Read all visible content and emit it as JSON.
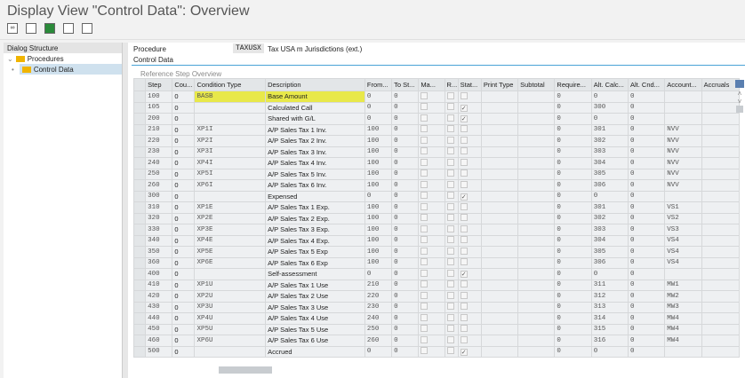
{
  "title": "Display View \"Control Data\": Overview",
  "toolbar": [
    "glasses-icon",
    "select-all-icon",
    "select-block-icon",
    "deselect-all-icon",
    "print-icon"
  ],
  "left": {
    "header": "Dialog Structure",
    "items": [
      {
        "label": "Procedures"
      },
      {
        "label": "Control Data",
        "selected": true
      }
    ]
  },
  "procedure": {
    "label": "Procedure",
    "code": "TAXUSX",
    "description": "Tax USA m Jurisdictions (ext.)"
  },
  "tab": "Control Data",
  "section": "Reference Step Overview",
  "columns": [
    "Step",
    "Cou...",
    "Condition Type",
    "Description",
    "From...",
    "To St...",
    "Ma...",
    "R...",
    "Stat...",
    "Print Type",
    "Subtotal",
    "Require...",
    "Alt. Calc...",
    "Alt. Cnd...",
    "Account...",
    "Accruals"
  ],
  "rows": [
    [
      "100",
      "0",
      "BASB",
      "Base Amount",
      "0",
      "0",
      false,
      false,
      false,
      "",
      "",
      "0",
      "0",
      "0",
      "",
      ""
    ],
    [
      "105",
      "0",
      "",
      "Calculated Call",
      "0",
      "0",
      false,
      false,
      true,
      "",
      "",
      "0",
      "300",
      "0",
      "",
      ""
    ],
    [
      "200",
      "0",
      "",
      "Shared with G/L",
      "0",
      "0",
      false,
      false,
      true,
      "",
      "",
      "0",
      "0",
      "0",
      "",
      ""
    ],
    [
      "210",
      "0",
      "XP1I",
      "A/P Sales Tax 1 Inv.",
      "100",
      "0",
      false,
      false,
      false,
      "",
      "",
      "0",
      "301",
      "0",
      "NVV",
      ""
    ],
    [
      "220",
      "0",
      "XP2I",
      "A/P Sales Tax 2 Inv.",
      "100",
      "0",
      false,
      false,
      false,
      "",
      "",
      "0",
      "302",
      "0",
      "NVV",
      ""
    ],
    [
      "230",
      "0",
      "XP3I",
      "A/P Sales Tax 3 Inv.",
      "100",
      "0",
      false,
      false,
      false,
      "",
      "",
      "0",
      "303",
      "0",
      "NVV",
      ""
    ],
    [
      "240",
      "0",
      "XP4I",
      "A/P Sales Tax 4 Inv.",
      "100",
      "0",
      false,
      false,
      false,
      "",
      "",
      "0",
      "304",
      "0",
      "NVV",
      ""
    ],
    [
      "250",
      "0",
      "XP5I",
      "A/P Sales Tax 5 Inv.",
      "100",
      "0",
      false,
      false,
      false,
      "",
      "",
      "0",
      "305",
      "0",
      "NVV",
      ""
    ],
    [
      "260",
      "0",
      "XP6I",
      "A/P Sales Tax 6 Inv.",
      "100",
      "0",
      false,
      false,
      false,
      "",
      "",
      "0",
      "306",
      "0",
      "NVV",
      ""
    ],
    [
      "300",
      "0",
      "",
      "Expensed",
      "0",
      "0",
      false,
      false,
      true,
      "",
      "",
      "0",
      "0",
      "0",
      "",
      ""
    ],
    [
      "310",
      "0",
      "XP1E",
      "A/P Sales Tax 1 Exp.",
      "100",
      "0",
      false,
      false,
      false,
      "",
      "",
      "0",
      "301",
      "0",
      "VS1",
      ""
    ],
    [
      "320",
      "0",
      "XP2E",
      "A/P Sales Tax 2 Exp.",
      "100",
      "0",
      false,
      false,
      false,
      "",
      "",
      "0",
      "302",
      "0",
      "VS2",
      ""
    ],
    [
      "330",
      "0",
      "XP3E",
      "A/P Sales Tax 3 Exp.",
      "100",
      "0",
      false,
      false,
      false,
      "",
      "",
      "0",
      "303",
      "0",
      "VS3",
      ""
    ],
    [
      "340",
      "0",
      "XP4E",
      "A/P Sales Tax 4 Exp.",
      "100",
      "0",
      false,
      false,
      false,
      "",
      "",
      "0",
      "304",
      "0",
      "VS4",
      ""
    ],
    [
      "350",
      "0",
      "XP5E",
      "A/P Sales Tax 5 Exp",
      "100",
      "0",
      false,
      false,
      false,
      "",
      "",
      "0",
      "305",
      "0",
      "VS4",
      ""
    ],
    [
      "360",
      "0",
      "XP6E",
      "A/P Sales Tax 6 Exp",
      "100",
      "0",
      false,
      false,
      false,
      "",
      "",
      "0",
      "306",
      "0",
      "VS4",
      ""
    ],
    [
      "400",
      "0",
      "",
      "Self-assessment",
      "0",
      "0",
      false,
      false,
      true,
      "",
      "",
      "0",
      "0",
      "0",
      "",
      ""
    ],
    [
      "410",
      "0",
      "XP1U",
      "A/P Sales Tax 1 Use",
      "210",
      "0",
      false,
      false,
      false,
      "",
      "",
      "0",
      "311",
      "0",
      "MW1",
      ""
    ],
    [
      "420",
      "0",
      "XP2U",
      "A/P Sales Tax 2 Use",
      "220",
      "0",
      false,
      false,
      false,
      "",
      "",
      "0",
      "312",
      "0",
      "MW2",
      ""
    ],
    [
      "430",
      "0",
      "XP3U",
      "A/P Sales Tax 3 Use",
      "230",
      "0",
      false,
      false,
      false,
      "",
      "",
      "0",
      "313",
      "0",
      "MW3",
      ""
    ],
    [
      "440",
      "0",
      "XP4U",
      "A/P Sales Tax 4 Use",
      "240",
      "0",
      false,
      false,
      false,
      "",
      "",
      "0",
      "314",
      "0",
      "MW4",
      ""
    ],
    [
      "450",
      "0",
      "XP5U",
      "A/P Sales Tax 5 Use",
      "250",
      "0",
      false,
      false,
      false,
      "",
      "",
      "0",
      "315",
      "0",
      "MW4",
      ""
    ],
    [
      "460",
      "0",
      "XP6U",
      "A/P Sales Tax 6 Use",
      "260",
      "0",
      false,
      false,
      false,
      "",
      "",
      "0",
      "316",
      "0",
      "MW4",
      ""
    ],
    [
      "500",
      "0",
      "",
      "Accrued",
      "0",
      "0",
      false,
      false,
      true,
      "",
      "",
      "0",
      "0",
      "0",
      "",
      ""
    ]
  ],
  "highlight_color": "#e8e84a"
}
